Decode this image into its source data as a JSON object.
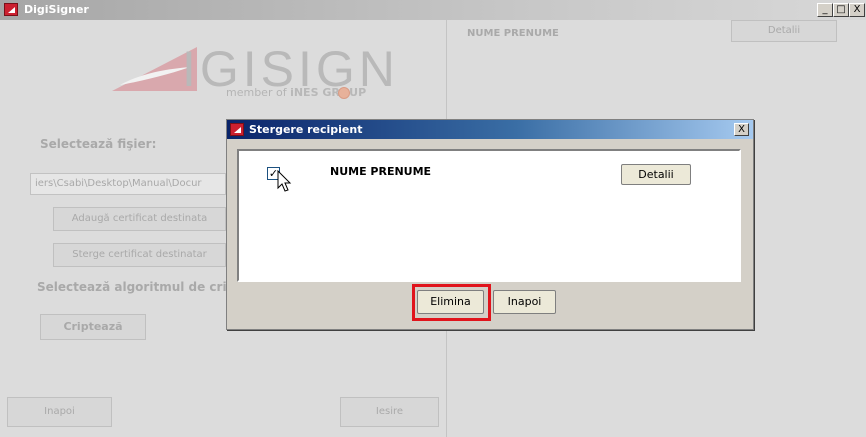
{
  "main_window": {
    "title": "DigiSigner",
    "controls": [
      "_",
      "□",
      "X"
    ]
  },
  "logo": {
    "text": "IGISIGN",
    "tagline_prefix": "member of",
    "tagline_brand": "iNES GROUP"
  },
  "left_panel": {
    "select_file_label": "Selectează fişier:",
    "file_path": "iers\\Csabi\\Desktop\\Manual\\Docur",
    "add_cert_button": "Adaugă certificat destinata",
    "remove_cert_button": "Sterge certificat destinatar",
    "select_algorithm_label": "Selectează algoritmul de crip",
    "encrypt_button": "Criptează",
    "back_button": "Inapoi",
    "exit_button": "Iesire"
  },
  "right_panel": {
    "recipient_name": "NUME PRENUME",
    "details_button": "Detalii"
  },
  "dialog": {
    "title": "Stergere recipient",
    "close": "X",
    "recipients": [
      {
        "name": "NUME PRENUME",
        "checked": true,
        "details_button": "Detalii"
      }
    ],
    "check_mark": "✓",
    "delete_button": "Elimina",
    "back_button": "Inapoi"
  },
  "colors": {
    "highlight": "#e0141c",
    "logo_red": "#cc2030"
  }
}
